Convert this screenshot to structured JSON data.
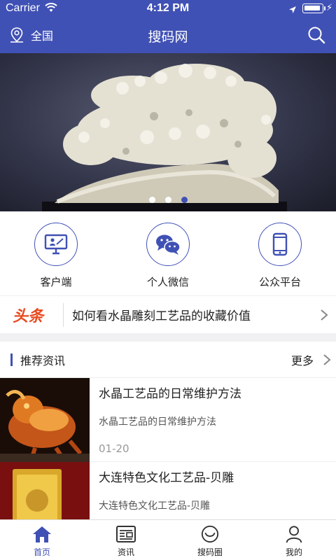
{
  "status_bar": {
    "carrier": "Carrier",
    "time": "4:12 PM"
  },
  "nav": {
    "location": "全国",
    "title": "搜码网"
  },
  "banner": {
    "slide_count": 3,
    "active_slide": 3
  },
  "quick_links": [
    {
      "label": "客户端",
      "icon": "desktop-monitor-icon"
    },
    {
      "label": "个人微信",
      "icon": "wechat-icon"
    },
    {
      "label": "公众平台",
      "icon": "smartphone-icon"
    }
  ],
  "headline": {
    "tag": "头条",
    "text": "如何看水晶雕刻工艺品的收藏价值"
  },
  "recommended": {
    "title": "推荐资讯",
    "more_label": "更多",
    "items": [
      {
        "title": "水晶工艺品的日常维护方法",
        "summary": "水晶工艺品的日常维护方法",
        "date": "01-20"
      },
      {
        "title": "大连特色文化工艺品-贝雕",
        "summary": "大连特色文化工艺品-贝雕",
        "date": ""
      }
    ]
  },
  "tabbar": [
    {
      "label": "首页",
      "icon": "home-icon",
      "active": true
    },
    {
      "label": "资讯",
      "icon": "news-icon",
      "active": false
    },
    {
      "label": "搜码圈",
      "icon": "circle-smile-icon",
      "active": false
    },
    {
      "label": "我的",
      "icon": "person-icon",
      "active": false
    }
  ],
  "colors": {
    "primary": "#4051b5",
    "headline_tag": "#e8491d",
    "page_bg": "#ffffff"
  }
}
